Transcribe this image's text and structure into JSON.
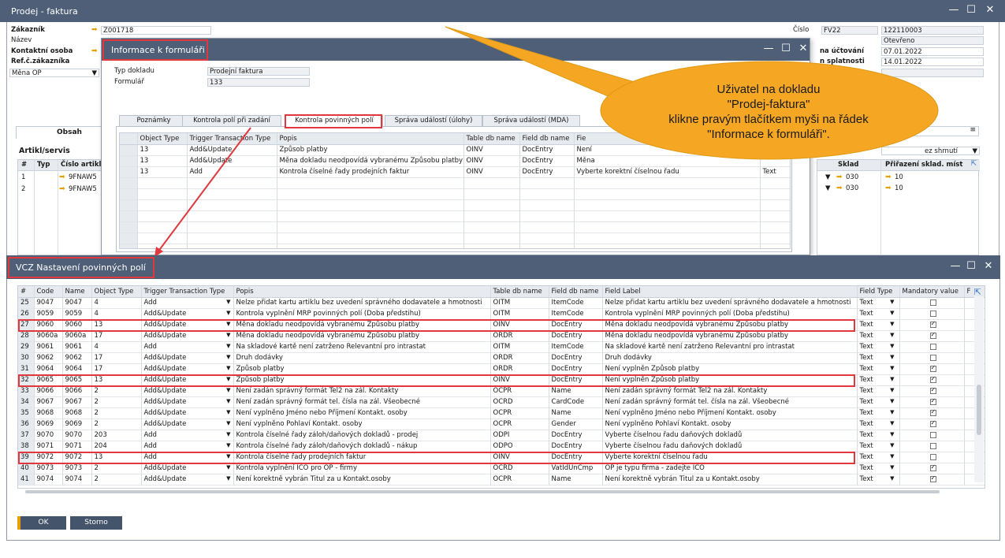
{
  "main_window": {
    "title": "Prodej - faktura",
    "controls": [
      "—",
      "☐",
      "✕"
    ]
  },
  "header": {
    "customer_label": "Zákazník",
    "customer_value": "Z001718",
    "name_label": "Název",
    "contact_label": "Kontaktní osoba",
    "ref_label": "Ref.č.zákazníka",
    "currency_value": "Měna OP",
    "number_label": "Číslo",
    "series_value": "FV22",
    "number_value": "122110003",
    "status_value": "Otevřeno",
    "posting_label": "na účtování",
    "posting_value": "07.01.2022",
    "due_label": "n splatnosti",
    "due_value": "14.01.2022"
  },
  "side_tab": {
    "content_label": "Obsah",
    "items_label": "Artikl/servis",
    "col_num": "#",
    "col_type": "Typ",
    "col_item": "Číslo artikl",
    "rows": [
      {
        "n": "1",
        "item": "9FNAW5"
      },
      {
        "n": "2",
        "item": "9FNAW5"
      }
    ]
  },
  "right_grid": {
    "summary_value": "ez shrnutí",
    "col_sklad": "Sklad",
    "col_prirazeni": "Přiřazení sklad. míst",
    "rows": [
      {
        "sklad": "030",
        "val": "10"
      },
      {
        "sklad": "030",
        "val": "10"
      }
    ]
  },
  "info_dialog": {
    "title": "Informace k formuláři",
    "controls": [
      "—",
      "☐",
      "✕"
    ],
    "doc_type_label": "Typ dokladu",
    "doc_type_value": "Prodejní faktura",
    "form_label": "Formulář",
    "form_value": "133",
    "tabs": [
      "Poznámky",
      "Kontrola polí při zadání",
      "Kontrola povinných polí",
      "Správa událostí (úlohy)",
      "Správa událostí (MDA)"
    ],
    "columns": [
      "Object Type",
      "Trigger Transaction Type",
      "Popis",
      "Table db name",
      "Field db name",
      "Fie"
    ],
    "rows": [
      {
        "obj": "13",
        "trig": "Add&Update",
        "popis": "Způsob platby",
        "table": "OINV",
        "field": "DocEntry",
        "label": "Není"
      },
      {
        "obj": "13",
        "trig": "Add&Update",
        "popis": "Měna dokladu neodpovídá vybranému Způsobu platby",
        "table": "OINV",
        "field": "DocEntry",
        "label": "Měna"
      },
      {
        "obj": "13",
        "trig": "Add",
        "popis": "Kontrola číselné řady prodejních faktur",
        "table": "OINV",
        "field": "DocEntry",
        "label": "Vyberte korektní číselnou řadu",
        "type": "Text"
      }
    ]
  },
  "callout": {
    "line1": "Uživatel na dokladu",
    "line2": "\"Prodej-faktura\"",
    "line3": "klikne pravým tlačítkem myši na řádek",
    "line4": "\"Informace k formuláři\"."
  },
  "vcz_dialog": {
    "title": "VCZ Nastavení povinných polí",
    "controls": [
      "—",
      "☐",
      "✕"
    ],
    "columns": [
      "#",
      "Code",
      "Name",
      "Object Type",
      "Trigger Transaction Type",
      "Popis",
      "Table db name",
      "Field db name",
      "Field Label",
      "Field Type",
      "Mandatory value",
      "F"
    ],
    "rows": [
      {
        "n": "25",
        "code": "9047",
        "name": "9047",
        "obj": "4",
        "trig": "Add",
        "popis": "Nelze přidat kartu artiklu bez uvedení správného dodavatele a hmotnosti",
        "table": "OITM",
        "field": "ItemCode",
        "label": "Nelze přidat kartu artiklu bez uvedení správného dodavatele a hmotnosti",
        "type": "Text",
        "mand": false
      },
      {
        "n": "26",
        "code": "9059",
        "name": "9059",
        "obj": "4",
        "trig": "Add&Update",
        "popis": "Kontrola vyplnění MRP povinných polí (Doba předstihu)",
        "table": "OITM",
        "field": "ItemCode",
        "label": "Kontrola vyplnění MRP povinných polí (Doba předstihu)",
        "type": "Text",
        "mand": false
      },
      {
        "n": "27",
        "code": "9060",
        "name": "9060",
        "obj": "13",
        "trig": "Add&Update",
        "popis": "Měna dokladu neodpovídá vybranému Způsobu platby",
        "table": "OINV",
        "field": "DocEntry",
        "label": "Měna dokladu neodpovídá vybranému Způsobu platby",
        "type": "Text",
        "mand": true
      },
      {
        "n": "28",
        "code": "9060a",
        "name": "9060a",
        "obj": "17",
        "trig": "Add&Update",
        "popis": "Měna dokladu neodpovídá vybranému Způsobu platby",
        "table": "ORDR",
        "field": "DocEntry",
        "label": "Měna dokladu neodpovídá vybranému Způsobu platby",
        "type": "Text",
        "mand": true
      },
      {
        "n": "29",
        "code": "9061",
        "name": "9061",
        "obj": "4",
        "trig": "Add",
        "popis": "Na skladové kartě není zatrženo Relevantní pro intrastat",
        "table": "OITM",
        "field": "ItemCode",
        "label": "Na skladové kartě není zatrženo Relevantní pro intrastat",
        "type": "Text",
        "mand": false
      },
      {
        "n": "30",
        "code": "9062",
        "name": "9062",
        "obj": "17",
        "trig": "Add&Update",
        "popis": "Druh dodávky",
        "table": "ORDR",
        "field": "DocEntry",
        "label": "Druh dodávky",
        "type": "Text",
        "mand": false
      },
      {
        "n": "31",
        "code": "9064",
        "name": "9064",
        "obj": "17",
        "trig": "Add&Update",
        "popis": "Způsob platby",
        "table": "ORDR",
        "field": "DocEntry",
        "label": "Není vyplněn Způsob platby",
        "type": "Text",
        "mand": true
      },
      {
        "n": "32",
        "code": "9065",
        "name": "9065",
        "obj": "13",
        "trig": "Add&Update",
        "popis": "Způsob platby",
        "table": "OINV",
        "field": "DocEntry",
        "label": "Není vyplněn Způsob platby",
        "type": "Text",
        "mand": true
      },
      {
        "n": "33",
        "code": "9066",
        "name": "9066",
        "obj": "2",
        "trig": "Add&Update",
        "popis": "Není zadán správný formát Tel2 na zál. Kontakty",
        "table": "OCPR",
        "field": "Name",
        "label": "Není zadán správný formát Tel2 na zál. Kontakty",
        "type": "Text",
        "mand": true
      },
      {
        "n": "34",
        "code": "9067",
        "name": "9067",
        "obj": "2",
        "trig": "Add&Update",
        "popis": "Není zadán správný formát tel. čísla na zál. Všeobecné",
        "table": "OCRD",
        "field": "CardCode",
        "label": "Není zadán správný formát tel. čísla na zál. Všeobecné",
        "type": "Text",
        "mand": true
      },
      {
        "n": "35",
        "code": "9068",
        "name": "9068",
        "obj": "2",
        "trig": "Add&Update",
        "popis": "Není vyplněno Jméno nebo Příjmení Kontakt. osoby",
        "table": "OCPR",
        "field": "Name",
        "label": "Není vyplněno Jméno nebo Příjmení Kontakt. osoby",
        "type": "Text",
        "mand": true
      },
      {
        "n": "36",
        "code": "9069",
        "name": "9069",
        "obj": "2",
        "trig": "Add&Update",
        "popis": "Není vyplněno Pohlaví Kontakt. osoby",
        "table": "OCPR",
        "field": "Gender",
        "label": "Není vyplněno Pohlaví Kontakt. osoby",
        "type": "Text",
        "mand": true
      },
      {
        "n": "37",
        "code": "9070",
        "name": "9070",
        "obj": "203",
        "trig": "Add",
        "popis": "Kontrola číselné řady záloh/daňových dokladů - prodej",
        "table": "ODPI",
        "field": "DocEntry",
        "label": "Vyberte číselnou řadu daňových dokladů",
        "type": "Text",
        "mand": false
      },
      {
        "n": "38",
        "code": "9071",
        "name": "9071",
        "obj": "204",
        "trig": "Add",
        "popis": "Kontrola číselné řady záloh/daňových dokladů - nákup",
        "table": "ODPO",
        "field": "DocEntry",
        "label": "Vyberte číselnou řadu daňových dokladů",
        "type": "Text",
        "mand": false
      },
      {
        "n": "39",
        "code": "9072",
        "name": "9072",
        "obj": "13",
        "trig": "Add",
        "popis": "Kontrola číselné řady prodejních faktur",
        "table": "OINV",
        "field": "DocEntry",
        "label": "Vyberte korektní číselnou řadu",
        "type": "Text",
        "mand": false
      },
      {
        "n": "40",
        "code": "9073",
        "name": "9073",
        "obj": "2",
        "trig": "Add&Update",
        "popis": "Kontrola vyplnění IČO pro OP - firmy",
        "table": "OCRD",
        "field": "VatIdUnCmp",
        "label": "OP je typu firma - zadejte IČO",
        "type": "Text",
        "mand": true
      },
      {
        "n": "41",
        "code": "9074",
        "name": "9074",
        "obj": "2",
        "trig": "Add&Update",
        "popis": "Není korektně vybrán Titul za u Kontakt.osoby",
        "table": "OCPR",
        "field": "Name",
        "label": "Není korektně vybrán Titul za u Kontakt.osoby",
        "type": "Text",
        "mand": true
      }
    ],
    "ok_label": "OK",
    "cancel_label": "Storno"
  },
  "colors": {
    "titlebar": "#4e5f77",
    "accent": "#e8a000",
    "highlight": "#e0383c",
    "callout": "#f5a623"
  }
}
